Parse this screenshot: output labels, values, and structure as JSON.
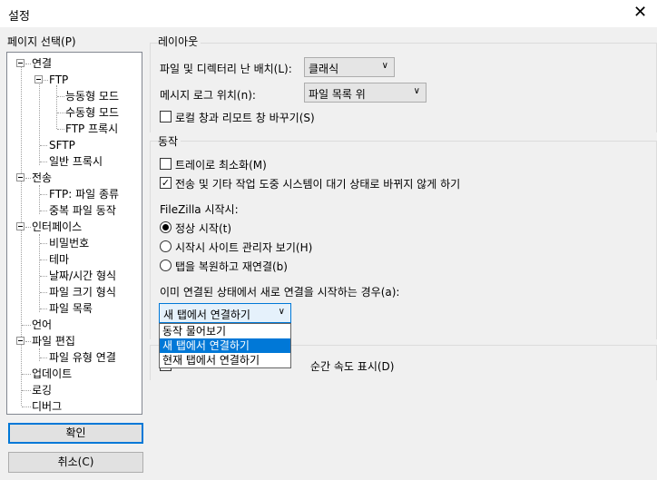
{
  "window": {
    "title": "설정",
    "close_glyph": "✕"
  },
  "sidebar": {
    "label": "페이지 선택(P)",
    "tree": [
      {
        "label": "연결"
      },
      {
        "label": "FTP"
      },
      {
        "label": "능동형 모드"
      },
      {
        "label": "수동형 모드"
      },
      {
        "label": "FTP 프록시"
      },
      {
        "label": "SFTP"
      },
      {
        "label": "일반 프록시"
      },
      {
        "label": "전송"
      },
      {
        "label": "FTP: 파일 종류"
      },
      {
        "label": "중복 파일 동작"
      },
      {
        "label": "인터페이스"
      },
      {
        "label": "비밀번호"
      },
      {
        "label": "테마"
      },
      {
        "label": "날짜/시간 형식"
      },
      {
        "label": "파일 크기 형식"
      },
      {
        "label": "파일 목록"
      },
      {
        "label": "언어"
      },
      {
        "label": "파일 편집"
      },
      {
        "label": "파일 유형 연결"
      },
      {
        "label": "업데이트"
      },
      {
        "label": "로깅"
      },
      {
        "label": "디버그"
      }
    ],
    "ok_button": "확인",
    "cancel_button": "취소(C)"
  },
  "layout": {
    "group_title": "레이아웃",
    "file_dir_layout_label": "파일 및 디렉터리 난 배치(L):",
    "file_dir_layout_value": "클래식",
    "message_log_position_label": "메시지 로그 위치(n):",
    "message_log_position_value": "파일 목록 위",
    "swap_panes_label": "로컬 창과 리모트 창 바꾸기(S)",
    "swap_panes_checked": false
  },
  "behaviour": {
    "group_title": "동작",
    "minimize_to_tray_label": "트레이로 최소화(M)",
    "minimize_to_tray_checked": false,
    "prevent_standby_label": "전송 및 기타 작업 도중 시스템이 대기 상태로 바뀌지 않게 하기",
    "prevent_standby_checked": true,
    "startup_label": "FileZilla 시작시:",
    "startup_options": [
      {
        "label": "정상 시작(t)",
        "selected": true
      },
      {
        "label": "시작시 사이트 관리자 보기(H)",
        "selected": false
      },
      {
        "label": "탭을 복원하고 재연결(b)",
        "selected": false
      }
    ],
    "new_connection_label": "이미 연결된 상태에서 새로 연결을 시작하는 경우(a):",
    "new_connection_value": "새 탭에서 연결하기",
    "new_connection_options": [
      "동작 물어보기",
      "새 탭에서 연결하기",
      "현재 탭에서 연결하기"
    ],
    "new_connection_selected_index": 1
  },
  "transfer_speed": {
    "partial_label": "순간 속도 표시(D)"
  }
}
